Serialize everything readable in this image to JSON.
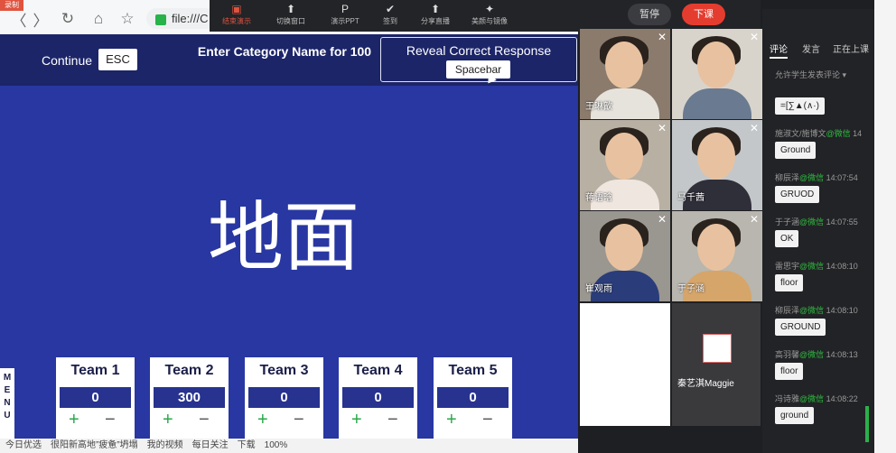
{
  "browser": {
    "rec_badge": "录制",
    "back": "〈",
    "forward": "〉",
    "reload": "↻",
    "home": "⌂",
    "star": "☆",
    "url": "file:///C"
  },
  "live_toolbar": {
    "items": [
      {
        "icon": "▣",
        "label": "结束演示"
      },
      {
        "icon": "⬆",
        "label": "切换窗口"
      },
      {
        "icon": "P",
        "label": "演示PPT"
      },
      {
        "icon": "✔",
        "label": "签到"
      },
      {
        "icon": "⬆",
        "label": "分享直播"
      },
      {
        "icon": "✦",
        "label": "美颜与镜像"
      }
    ],
    "pause": "暂停",
    "end": "下课"
  },
  "game": {
    "continue_label": "Continue",
    "esc_key": "ESC",
    "enter_category": "Enter Category Name for 100",
    "reveal_label": "Reveal Correct Response",
    "spacebar_key": "Spacebar",
    "answer": "地面",
    "menu_letters": "M E N U",
    "teams": [
      {
        "name": "Team 1",
        "score": "0",
        "plus": "+",
        "minus": "−"
      },
      {
        "name": "Team 2",
        "score": "300",
        "plus": "+",
        "minus": "−"
      },
      {
        "name": "Team 3",
        "score": "0",
        "plus": "+",
        "minus": "−"
      },
      {
        "name": "Team 4",
        "score": "0",
        "plus": "+",
        "minus": "−"
      },
      {
        "name": "Team 5",
        "score": "0",
        "plus": "+",
        "minus": "−"
      }
    ]
  },
  "taskbar": [
    "今日优选",
    "很阳新高地”疲惫”坍塌",
    "我的视频",
    "每日关注",
    "下载",
    "100%"
  ],
  "videos": [
    {
      "name": "王琳歆",
      "bg": "#8a7b6d",
      "shirt": "#e6e3dc"
    },
    {
      "name": "",
      "bg": "#d8d4cc",
      "shirt": "#6a7a90"
    },
    {
      "name": "蒋语晗",
      "bg": "#b9b0a4",
      "shirt": "#efe6df"
    },
    {
      "name": "马千茜",
      "bg": "#c3c7c9",
      "shirt": "#2f2f3a"
    },
    {
      "name": "崔观雨",
      "bg": "#9a9690",
      "shirt": "#2a3d7a"
    },
    {
      "name": "于子涵",
      "bg": "#b8b6ae",
      "shirt": "#d6a56a"
    }
  ],
  "maggie": {
    "name": "秦艺淇Maggie"
  },
  "comments": {
    "tabs": [
      "评论",
      "发言",
      "正在上课"
    ],
    "permission": "允许学生发表评论 ▾",
    "items": [
      {
        "user": "",
        "src": "",
        "time": "",
        "text": "=[∑▲(∧·)"
      },
      {
        "user": "施淑文/施博文",
        "src": "@微信",
        "time": "14",
        "text": "Ground"
      },
      {
        "user": "柳辰泽",
        "src": "@微信",
        "time": "14:07:54",
        "text": "GRUOD"
      },
      {
        "user": "于子涵",
        "src": "@微信",
        "time": "14:07:55",
        "text": "OK"
      },
      {
        "user": "雷思宇",
        "src": "@微信",
        "time": "14:08:10",
        "text": "floor"
      },
      {
        "user": "柳辰泽",
        "src": "@微信",
        "time": "14:08:10",
        "text": "GROUND"
      },
      {
        "user": "高羽馨",
        "src": "@微信",
        "time": "14:08:13",
        "text": "floor"
      },
      {
        "user": "冯诗雅",
        "src": "@微信",
        "time": "14:08:22",
        "text": "ground"
      }
    ]
  }
}
